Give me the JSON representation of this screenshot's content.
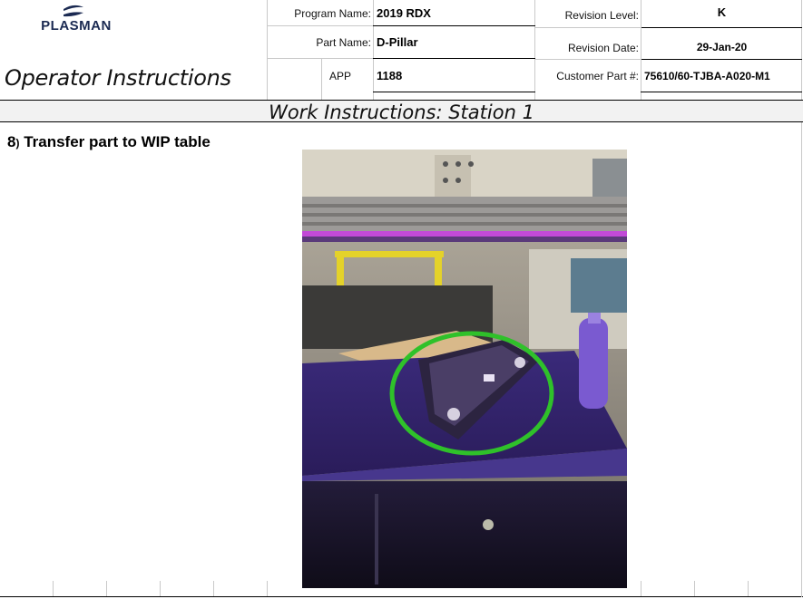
{
  "header": {
    "logo_text": "PLASMAN",
    "title": "Operator Instructions",
    "program_name_label": "Program Name:",
    "program_name_value": "2019 RDX",
    "part_name_label": "Part Name:",
    "part_name_value": "D-Pillar",
    "app_label": "APP",
    "app_value": "1188",
    "revision_level_label": "Revision Level:",
    "revision_level_value": "K",
    "revision_date_label": "Revision Date:",
    "revision_date_value": "29-Jan-20",
    "customer_part_label": "Customer Part #:",
    "customer_part_value": "75610/60-TJBA-A020-M1"
  },
  "section": {
    "title": "Work Instructions: Station 1"
  },
  "step": {
    "number": "8",
    "suffix": ")",
    "text": "Transfer part to WIP table"
  },
  "photo": {
    "description_icon": "workstation-photo",
    "highlight_color": "#2fc12a"
  },
  "colors": {
    "logo_blue": "#1b2a52",
    "band_bg": "#f2f2f2",
    "grid_line": "#c9c9c9"
  }
}
